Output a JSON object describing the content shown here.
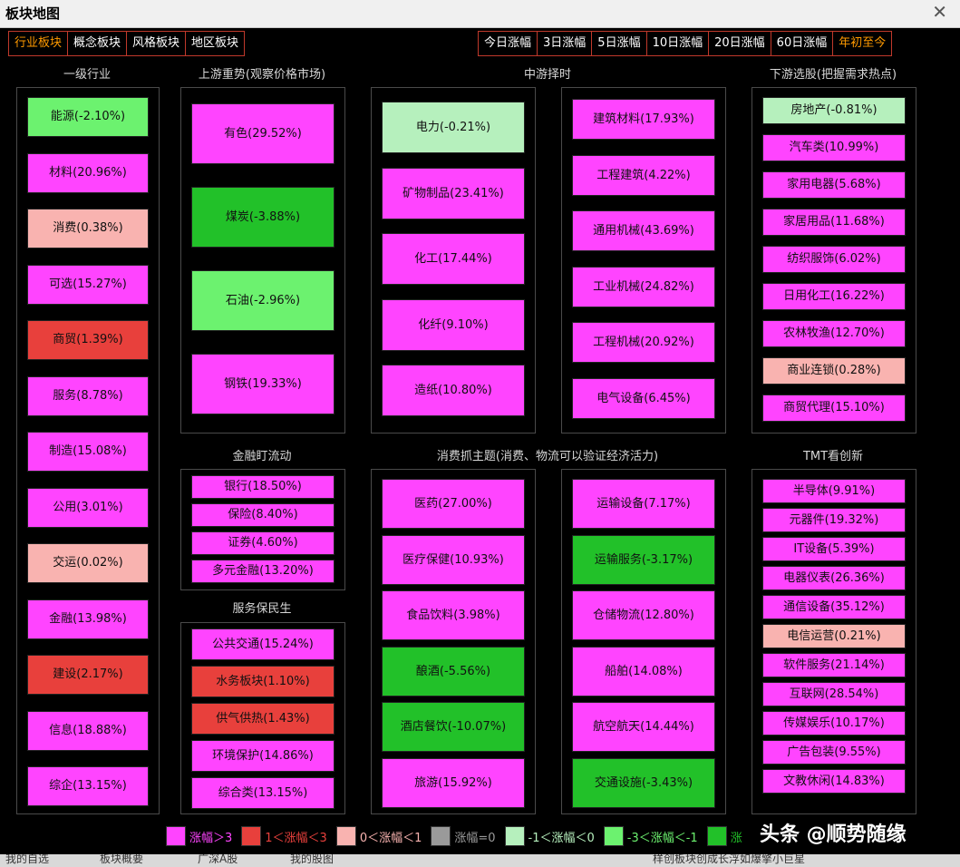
{
  "window": {
    "title": "板块地图",
    "close": "✕"
  },
  "left_tabs": [
    {
      "label": "行业板块",
      "active": true
    },
    {
      "label": "概念板块",
      "active": false
    },
    {
      "label": "风格板块",
      "active": false
    },
    {
      "label": "地区板块",
      "active": false
    }
  ],
  "right_tabs": [
    {
      "label": "今日涨幅",
      "active": false
    },
    {
      "label": "3日涨幅",
      "active": false
    },
    {
      "label": "5日涨幅",
      "active": false
    },
    {
      "label": "10日涨幅",
      "active": false
    },
    {
      "label": "20日涨幅",
      "active": false
    },
    {
      "label": "60日涨幅",
      "active": false
    },
    {
      "label": "年初至今",
      "active": true
    }
  ],
  "colors": {
    "up_gt3": "#ff44ff",
    "up_1_3": "#e8403c",
    "up_0_1": "#f9b3b0",
    "flat": "#9a9a9a",
    "dn_0_1": "#b6f0bd",
    "dn_1_3": "#6cf26f",
    "dn_gt3": "#22c129"
  },
  "sections": {
    "level1": "一级行业",
    "upstream": "上游重势(观察价格市场)",
    "midstream": "中游择时",
    "downstream": "下游选股(把握需求热点)",
    "finance": "金融盯流动",
    "service": "服务保民生",
    "consumer": "消费抓主题(消费、物流可以验证经济活力)",
    "tmt": "TMT看创新"
  },
  "panels": {
    "level1": [
      {
        "label": "能源(-2.10%)",
        "c": "dn_1_3"
      },
      {
        "label": "材料(20.96%)",
        "c": "up_gt3"
      },
      {
        "label": "消费(0.38%)",
        "c": "up_0_1"
      },
      {
        "label": "可选(15.27%)",
        "c": "up_gt3"
      },
      {
        "label": "商贸(1.39%)",
        "c": "up_1_3"
      },
      {
        "label": "服务(8.78%)",
        "c": "up_gt3"
      },
      {
        "label": "制造(15.08%)",
        "c": "up_gt3"
      },
      {
        "label": "公用(3.01%)",
        "c": "up_gt3"
      },
      {
        "label": "交运(0.02%)",
        "c": "up_0_1"
      },
      {
        "label": "金融(13.98%)",
        "c": "up_gt3"
      },
      {
        "label": "建设(2.17%)",
        "c": "up_1_3"
      },
      {
        "label": "信息(18.88%)",
        "c": "up_gt3"
      },
      {
        "label": "综企(13.15%)",
        "c": "up_gt3"
      }
    ],
    "upstream": [
      {
        "label": "有色(29.52%)",
        "c": "up_gt3"
      },
      {
        "label": "煤炭(-3.88%)",
        "c": "dn_gt3"
      },
      {
        "label": "石油(-2.96%)",
        "c": "dn_1_3"
      },
      {
        "label": "钢铁(19.33%)",
        "c": "up_gt3"
      }
    ],
    "mid1": [
      {
        "label": "电力(-0.21%)",
        "c": "dn_0_1"
      },
      {
        "label": "矿物制品(23.41%)",
        "c": "up_gt3"
      },
      {
        "label": "化工(17.44%)",
        "c": "up_gt3"
      },
      {
        "label": "化纤(9.10%)",
        "c": "up_gt3"
      },
      {
        "label": "造纸(10.80%)",
        "c": "up_gt3"
      }
    ],
    "mid2": [
      {
        "label": "建筑材料(17.93%)",
        "c": "up_gt3"
      },
      {
        "label": "工程建筑(4.22%)",
        "c": "up_gt3"
      },
      {
        "label": "通用机械(43.69%)",
        "c": "up_gt3"
      },
      {
        "label": "工业机械(24.82%)",
        "c": "up_gt3"
      },
      {
        "label": "工程机械(20.92%)",
        "c": "up_gt3"
      },
      {
        "label": "电气设备(6.45%)",
        "c": "up_gt3"
      }
    ],
    "downstream": [
      {
        "label": "房地产(-0.81%)",
        "c": "dn_0_1"
      },
      {
        "label": "汽车类(10.99%)",
        "c": "up_gt3"
      },
      {
        "label": "家用电器(5.68%)",
        "c": "up_gt3"
      },
      {
        "label": "家居用品(11.68%)",
        "c": "up_gt3"
      },
      {
        "label": "纺织服饰(6.02%)",
        "c": "up_gt3"
      },
      {
        "label": "日用化工(16.22%)",
        "c": "up_gt3"
      },
      {
        "label": "农林牧渔(12.70%)",
        "c": "up_gt3"
      },
      {
        "label": "商业连锁(0.28%)",
        "c": "up_0_1"
      },
      {
        "label": "商贸代理(15.10%)",
        "c": "up_gt3"
      }
    ],
    "finance": [
      {
        "label": "银行(18.50%)",
        "c": "up_gt3"
      },
      {
        "label": "保险(8.40%)",
        "c": "up_gt3"
      },
      {
        "label": "证券(4.60%)",
        "c": "up_gt3"
      },
      {
        "label": "多元金融(13.20%)",
        "c": "up_gt3"
      }
    ],
    "service": [
      {
        "label": "公共交通(15.24%)",
        "c": "up_gt3"
      },
      {
        "label": "水务板块(1.10%)",
        "c": "up_1_3"
      },
      {
        "label": "供气供热(1.43%)",
        "c": "up_1_3"
      },
      {
        "label": "环境保护(14.86%)",
        "c": "up_gt3"
      },
      {
        "label": "综合类(13.15%)",
        "c": "up_gt3"
      }
    ],
    "cons1": [
      {
        "label": "医药(27.00%)",
        "c": "up_gt3"
      },
      {
        "label": "医疗保健(10.93%)",
        "c": "up_gt3"
      },
      {
        "label": "食品饮料(3.98%)",
        "c": "up_gt3"
      },
      {
        "label": "酿酒(-5.56%)",
        "c": "dn_gt3"
      },
      {
        "label": "酒店餐饮(-10.07%)",
        "c": "dn_gt3"
      },
      {
        "label": "旅游(15.92%)",
        "c": "up_gt3"
      }
    ],
    "cons2": [
      {
        "label": "运输设备(7.17%)",
        "c": "up_gt3"
      },
      {
        "label": "运输服务(-3.17%)",
        "c": "dn_gt3"
      },
      {
        "label": "仓储物流(12.80%)",
        "c": "up_gt3"
      },
      {
        "label": "船舶(14.08%)",
        "c": "up_gt3"
      },
      {
        "label": "航空航天(14.44%)",
        "c": "up_gt3"
      },
      {
        "label": "交通设施(-3.43%)",
        "c": "dn_gt3"
      }
    ],
    "tmt": [
      {
        "label": "半导体(9.91%)",
        "c": "up_gt3"
      },
      {
        "label": "元器件(19.32%)",
        "c": "up_gt3"
      },
      {
        "label": "IT设备(5.39%)",
        "c": "up_gt3"
      },
      {
        "label": "电器仪表(26.36%)",
        "c": "up_gt3"
      },
      {
        "label": "通信设备(35.12%)",
        "c": "up_gt3"
      },
      {
        "label": "电信运营(0.21%)",
        "c": "up_0_1"
      },
      {
        "label": "软件服务(21.14%)",
        "c": "up_gt3"
      },
      {
        "label": "互联网(28.54%)",
        "c": "up_gt3"
      },
      {
        "label": "传媒娱乐(10.17%)",
        "c": "up_gt3"
      },
      {
        "label": "广告包装(9.55%)",
        "c": "up_gt3"
      },
      {
        "label": "文教休闲(14.83%)",
        "c": "up_gt3"
      }
    ]
  },
  "legend": [
    {
      "label": "涨幅＞3",
      "c": "up_gt3",
      "tc": "#ff44ff"
    },
    {
      "label": "1＜涨幅＜3",
      "c": "up_1_3",
      "tc": "#e8403c"
    },
    {
      "label": "0＜涨幅＜1",
      "c": "up_0_1",
      "tc": "#f9b3b0"
    },
    {
      "label": "涨幅=0",
      "c": "flat",
      "tc": "#9a9a9a"
    },
    {
      "label": "-1＜涨幅＜0",
      "c": "dn_0_1",
      "tc": "#b6f0bd"
    },
    {
      "label": "-3＜涨幅＜-1",
      "c": "dn_1_3",
      "tc": "#6cf26f"
    },
    {
      "label": "涨",
      "c": "dn_gt3",
      "tc": "#22c129"
    }
  ],
  "watermark": "头条 @顺势随缘",
  "bottom_bar": [
    "我的自选",
    "板块概要",
    "广深A股",
    "我的股图",
    "样创板块创成长浮如爆擎小巨星"
  ]
}
